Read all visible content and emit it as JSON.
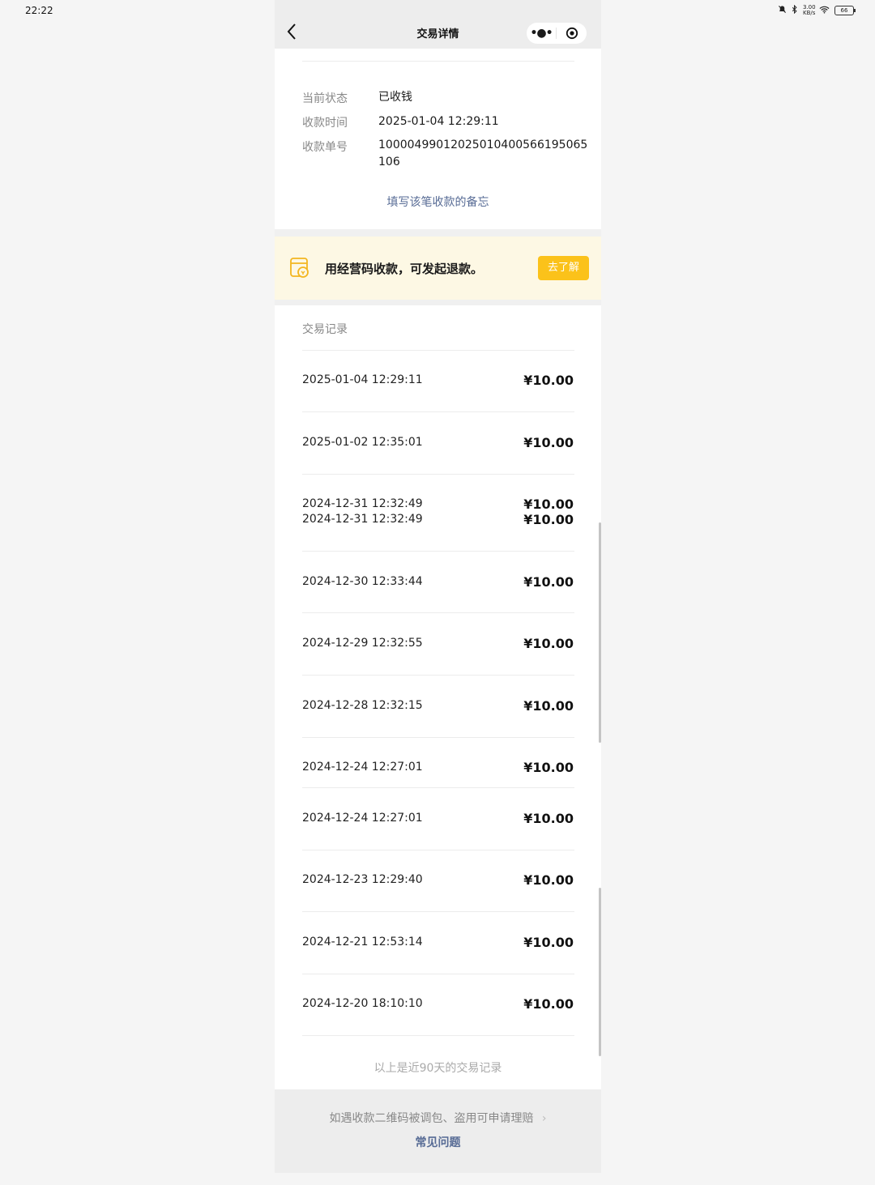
{
  "status_bar": {
    "time": "22:22",
    "network_speed": "3.00 KB/s",
    "battery": "66"
  },
  "header": {
    "title": "交易详情",
    "more_icon": "more-dots-icon",
    "close_icon": "target-icon"
  },
  "detail": {
    "rows": [
      {
        "label": "当前状态",
        "value": "已收钱"
      },
      {
        "label": "收款时间",
        "value": "2025-01-04 12:29:11"
      },
      {
        "label": "收款单号",
        "value_line1": "10000499012025010400566195065",
        "value_line2": "106"
      }
    ],
    "note_link": "填写该笔收款的备忘"
  },
  "banner": {
    "text": "用经营码收款，可发起退款。",
    "button": "去了解",
    "accent_color": "#fbc21a"
  },
  "records": {
    "title": "交易记录",
    "items": [
      {
        "date": "2025-01-04 12:29:11",
        "amount": "¥10.00"
      },
      {
        "date": "2025-01-02 12:35:01",
        "amount": "¥10.00"
      },
      {
        "date": "2024-12-31 12:32:49",
        "amount": "¥10.00"
      },
      {
        "date": "2024-12-31 12:32:49",
        "amount": "¥10.00"
      },
      {
        "date": "2024-12-30 12:33:44",
        "amount": "¥10.00"
      },
      {
        "date": "2024-12-29 12:32:55",
        "amount": "¥10.00"
      },
      {
        "date": "2024-12-28 12:32:15",
        "amount": "¥10.00"
      },
      {
        "date": "2024-12-24 12:27:01",
        "amount": "¥10.00"
      },
      {
        "date": "2024-12-24 12:27:01",
        "amount": "¥10.00"
      },
      {
        "date": "2024-12-23 12:29:40",
        "amount": "¥10.00"
      },
      {
        "date": "2024-12-21 12:53:14",
        "amount": "¥10.00"
      },
      {
        "date": "2024-12-20 18:10:10",
        "amount": "¥10.00"
      }
    ],
    "footer": "以上是近90天的交易记录"
  },
  "bottom": {
    "claim_text": "如遇收款二维码被调包、盗用可申请理赔",
    "faq_link": "常见问题",
    "link_color": "#576b95"
  }
}
